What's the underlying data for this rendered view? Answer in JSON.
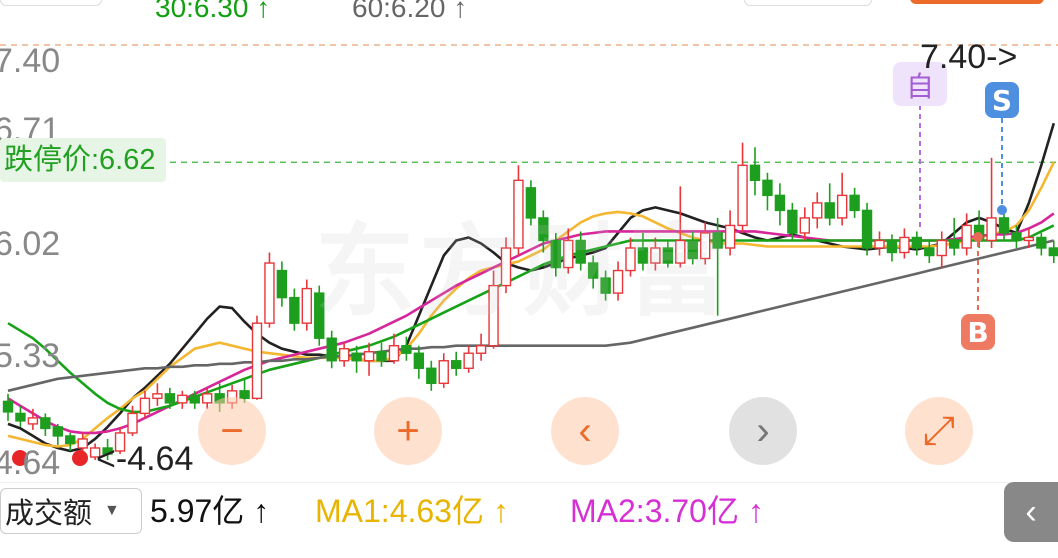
{
  "top_bar": {
    "ma30": "30:6.30",
    "ma60": "60:6.20",
    "up_arrow": "↑"
  },
  "price_axis": [
    "7.40",
    "6.71",
    "6.02",
    "5.33",
    "4.64"
  ],
  "limit_down_label": "跌停价:6.62",
  "high_marker": "7.40->",
  "low_marker": "<-4.64",
  "badges": {
    "self": "自",
    "sell": "S",
    "buy": "B"
  },
  "nav_buttons": {
    "zoom_out": "−",
    "zoom_in": "+",
    "prev": "‹",
    "next": "›",
    "expand": "⤢"
  },
  "volume_bar": {
    "selector": "成交额",
    "value": "5.97亿 ↑",
    "ma1": "MA1:4.63亿 ↑",
    "ma2": "MA2:3.70亿 ↑",
    "collapse": "‹"
  },
  "watermark": "东方财富",
  "colors": {
    "up": "#e8363a",
    "down": "#1e9e1e",
    "ma5": "#222222",
    "ma10": "#f5b731",
    "ma20": "#d6269a",
    "ma30": "#17a317",
    "ma60": "#666666",
    "accent": "#ec6a2a",
    "ma1_text": "#e8b400",
    "ma2_text": "#d62fd6"
  },
  "chart_data": {
    "type": "candlestick",
    "y_axis_ticks": [
      7.4,
      6.71,
      6.02,
      5.33,
      4.64
    ],
    "ylim": [
      4.4,
      7.55
    ],
    "reference_lines": {
      "high": 7.4,
      "limit_down": 6.62
    },
    "candles": [
      {
        "o": 5.03,
        "c": 4.96,
        "h": 5.08,
        "l": 4.9
      },
      {
        "o": 4.95,
        "c": 4.9,
        "h": 5.0,
        "l": 4.86
      },
      {
        "o": 4.88,
        "c": 4.92,
        "h": 4.98,
        "l": 4.84
      },
      {
        "o": 4.92,
        "c": 4.85,
        "h": 4.95,
        "l": 4.8
      },
      {
        "o": 4.86,
        "c": 4.8,
        "h": 4.88,
        "l": 4.74
      },
      {
        "o": 4.8,
        "c": 4.75,
        "h": 4.82,
        "l": 4.7
      },
      {
        "o": 4.72,
        "c": 4.78,
        "h": 4.82,
        "l": 4.66
      },
      {
        "o": 4.66,
        "c": 4.72,
        "h": 4.75,
        "l": 4.64
      },
      {
        "o": 4.72,
        "c": 4.68,
        "h": 4.78,
        "l": 4.64
      },
      {
        "o": 4.7,
        "c": 4.82,
        "h": 4.86,
        "l": 4.68
      },
      {
        "o": 4.82,
        "c": 4.95,
        "h": 5.0,
        "l": 4.8
      },
      {
        "o": 4.95,
        "c": 5.05,
        "h": 5.1,
        "l": 4.92
      },
      {
        "o": 5.05,
        "c": 5.08,
        "h": 5.15,
        "l": 5.0
      },
      {
        "o": 5.08,
        "c": 5.02,
        "h": 5.12,
        "l": 4.98
      },
      {
        "o": 5.02,
        "c": 5.07,
        "h": 5.1,
        "l": 4.98
      },
      {
        "o": 5.07,
        "c": 5.02,
        "h": 5.1,
        "l": 4.98
      },
      {
        "o": 5.02,
        "c": 5.08,
        "h": 5.12,
        "l": 4.98
      },
      {
        "o": 5.08,
        "c": 5.02,
        "h": 5.15,
        "l": 4.96
      },
      {
        "o": 5.02,
        "c": 5.1,
        "h": 5.14,
        "l": 4.98
      },
      {
        "o": 5.1,
        "c": 5.05,
        "h": 5.18,
        "l": 5.02
      },
      {
        "o": 5.05,
        "c": 5.55,
        "h": 5.6,
        "l": 5.04
      },
      {
        "o": 5.55,
        "c": 5.95,
        "h": 6.02,
        "l": 5.52
      },
      {
        "o": 5.9,
        "c": 5.72,
        "h": 5.96,
        "l": 5.66
      },
      {
        "o": 5.72,
        "c": 5.55,
        "h": 5.78,
        "l": 5.5
      },
      {
        "o": 5.55,
        "c": 5.78,
        "h": 5.84,
        "l": 5.5
      },
      {
        "o": 5.75,
        "c": 5.45,
        "h": 5.8,
        "l": 5.4
      },
      {
        "o": 5.45,
        "c": 5.3,
        "h": 5.5,
        "l": 5.25
      },
      {
        "o": 5.3,
        "c": 5.38,
        "h": 5.42,
        "l": 5.26
      },
      {
        "o": 5.35,
        "c": 5.3,
        "h": 5.4,
        "l": 5.22
      },
      {
        "o": 5.3,
        "c": 5.36,
        "h": 5.42,
        "l": 5.2
      },
      {
        "o": 5.36,
        "c": 5.3,
        "h": 5.42,
        "l": 5.26
      },
      {
        "o": 5.3,
        "c": 5.4,
        "h": 5.48,
        "l": 5.28
      },
      {
        "o": 5.4,
        "c": 5.35,
        "h": 5.46,
        "l": 5.3
      },
      {
        "o": 5.35,
        "c": 5.25,
        "h": 5.4,
        "l": 5.18
      },
      {
        "o": 5.25,
        "c": 5.15,
        "h": 5.3,
        "l": 5.1
      },
      {
        "o": 5.15,
        "c": 5.3,
        "h": 5.35,
        "l": 5.12
      },
      {
        "o": 5.3,
        "c": 5.25,
        "h": 5.36,
        "l": 5.2
      },
      {
        "o": 5.25,
        "c": 5.35,
        "h": 5.4,
        "l": 5.22
      },
      {
        "o": 5.35,
        "c": 5.4,
        "h": 5.48,
        "l": 5.3
      },
      {
        "o": 5.4,
        "c": 5.8,
        "h": 5.9,
        "l": 5.38
      },
      {
        "o": 5.8,
        "c": 6.05,
        "h": 6.12,
        "l": 5.75
      },
      {
        "o": 6.05,
        "c": 6.5,
        "h": 6.6,
        "l": 6.0
      },
      {
        "o": 6.45,
        "c": 6.25,
        "h": 6.5,
        "l": 6.2
      },
      {
        "o": 6.25,
        "c": 6.1,
        "h": 6.3,
        "l": 6.02
      },
      {
        "o": 6.1,
        "c": 5.92,
        "h": 6.15,
        "l": 5.86
      },
      {
        "o": 5.92,
        "c": 6.1,
        "h": 6.18,
        "l": 5.88
      },
      {
        "o": 6.1,
        "c": 5.95,
        "h": 6.16,
        "l": 5.9
      },
      {
        "o": 5.95,
        "c": 5.85,
        "h": 6.0,
        "l": 5.78
      },
      {
        "o": 5.85,
        "c": 5.75,
        "h": 5.9,
        "l": 5.7
      },
      {
        "o": 5.75,
        "c": 5.9,
        "h": 5.96,
        "l": 5.7
      },
      {
        "o": 5.9,
        "c": 6.05,
        "h": 6.12,
        "l": 5.86
      },
      {
        "o": 6.05,
        "c": 5.95,
        "h": 6.15,
        "l": 5.9
      },
      {
        "o": 5.95,
        "c": 6.05,
        "h": 6.12,
        "l": 5.9
      },
      {
        "o": 6.05,
        "c": 5.95,
        "h": 6.1,
        "l": 5.92
      },
      {
        "o": 5.95,
        "c": 6.1,
        "h": 6.46,
        "l": 5.92
      },
      {
        "o": 6.1,
        "c": 5.98,
        "h": 6.16,
        "l": 5.94
      },
      {
        "o": 5.98,
        "c": 6.15,
        "h": 6.22,
        "l": 5.94
      },
      {
        "o": 6.15,
        "c": 6.05,
        "h": 6.25,
        "l": 5.6
      },
      {
        "o": 6.05,
        "c": 6.2,
        "h": 6.3,
        "l": 6.0
      },
      {
        "o": 6.2,
        "c": 6.6,
        "h": 6.75,
        "l": 6.15
      },
      {
        "o": 6.6,
        "c": 6.5,
        "h": 6.72,
        "l": 6.4
      },
      {
        "o": 6.5,
        "c": 6.4,
        "h": 6.55,
        "l": 6.3
      },
      {
        "o": 6.4,
        "c": 6.3,
        "h": 6.48,
        "l": 6.2
      },
      {
        "o": 6.3,
        "c": 6.15,
        "h": 6.35,
        "l": 6.1
      },
      {
        "o": 6.15,
        "c": 6.25,
        "h": 6.32,
        "l": 6.1
      },
      {
        "o": 6.25,
        "c": 6.35,
        "h": 6.42,
        "l": 6.18
      },
      {
        "o": 6.35,
        "c": 6.25,
        "h": 6.48,
        "l": 6.2
      },
      {
        "o": 6.25,
        "c": 6.4,
        "h": 6.55,
        "l": 6.2
      },
      {
        "o": 6.4,
        "c": 6.3,
        "h": 6.45,
        "l": 6.25
      },
      {
        "o": 6.3,
        "c": 6.05,
        "h": 6.35,
        "l": 6.0
      },
      {
        "o": 6.05,
        "c": 6.1,
        "h": 6.16,
        "l": 6.0
      },
      {
        "o": 6.1,
        "c": 6.02,
        "h": 6.14,
        "l": 5.96
      },
      {
        "o": 6.02,
        "c": 6.12,
        "h": 6.18,
        "l": 5.98
      },
      {
        "o": 6.12,
        "c": 6.05,
        "h": 6.16,
        "l": 6.0
      },
      {
        "o": 6.05,
        "c": 6.0,
        "h": 6.1,
        "l": 5.95
      },
      {
        "o": 6.0,
        "c": 6.1,
        "h": 6.16,
        "l": 5.92
      },
      {
        "o": 6.1,
        "c": 6.05,
        "h": 6.25,
        "l": 6.0
      },
      {
        "o": 6.05,
        "c": 6.2,
        "h": 6.28,
        "l": 6.0
      },
      {
        "o": 6.2,
        "c": 6.1,
        "h": 6.3,
        "l": 6.05
      },
      {
        "o": 6.1,
        "c": 6.25,
        "h": 6.65,
        "l": 6.05
      },
      {
        "o": 6.25,
        "c": 6.15,
        "h": 6.3,
        "l": 6.1
      },
      {
        "o": 6.15,
        "c": 6.1,
        "h": 6.2,
        "l": 6.05
      },
      {
        "o": 6.1,
        "c": 6.12,
        "h": 6.18,
        "l": 6.05
      },
      {
        "o": 6.12,
        "c": 6.05,
        "h": 6.15,
        "l": 6.0
      },
      {
        "o": 6.05,
        "c": 6.0,
        "h": 6.1,
        "l": 5.95
      },
      {
        "o": 6.0,
        "c": 6.05,
        "h": 6.12,
        "l": 5.98
      },
      {
        "o": 6.05,
        "c": 6.02,
        "h": 6.1,
        "l": 5.98
      },
      {
        "o": 6.02,
        "c": 6.06,
        "h": 6.12,
        "l": 5.98
      },
      {
        "o": 6.06,
        "c": 6.02,
        "h": 6.14,
        "l": 5.98
      },
      {
        "o": 6.02,
        "c": 6.08,
        "h": 6.14,
        "l": 6.0
      },
      {
        "o": 6.08,
        "c": 6.04,
        "h": 6.14,
        "l": 6.0
      },
      {
        "o": 6.04,
        "c": 6.15,
        "h": 6.55,
        "l": 6.02
      },
      {
        "o": 6.15,
        "c": 6.35,
        "h": 6.42,
        "l": 6.1
      },
      {
        "o": 6.35,
        "c": 6.42,
        "h": 6.5,
        "l": 6.3
      },
      {
        "o": 6.42,
        "c": 6.25,
        "h": 6.48,
        "l": 6.2
      },
      {
        "o": 6.25,
        "c": 6.1,
        "h": 6.3,
        "l": 6.05
      },
      {
        "o": 6.1,
        "c": 6.02,
        "h": 6.16,
        "l": 5.98
      },
      {
        "o": 6.02,
        "c": 6.05,
        "h": 6.1,
        "l": 6.0
      },
      {
        "o": 6.05,
        "c": 6.15,
        "h": 6.25,
        "l": 6.02
      },
      {
        "o": 6.15,
        "c": 6.62,
        "h": 6.78,
        "l": 6.12
      },
      {
        "o": 6.62,
        "c": 7.3,
        "h": 7.4,
        "l": 6.6
      },
      {
        "o": 7.3,
        "c": 6.9,
        "h": 7.48,
        "l": 6.85
      }
    ],
    "ma_series": [
      {
        "name": "MA5",
        "color_key": "ma5",
        "values": [
          4.88,
          4.85,
          4.8,
          4.75,
          4.72,
          4.7,
          4.72,
          4.78,
          4.86,
          4.95,
          5.05,
          5.12,
          5.2,
          5.28,
          5.38,
          5.48,
          5.58,
          5.66,
          5.65,
          5.56,
          5.48,
          5.42,
          5.38,
          5.36,
          5.34,
          5.34,
          5.33,
          5.32,
          5.31,
          5.3,
          5.3,
          5.3,
          5.4,
          5.6,
          5.8,
          6.0,
          6.1,
          6.12,
          6.08,
          6.02,
          5.95,
          5.92,
          5.9,
          5.92,
          5.95,
          5.98,
          6.0,
          6.02,
          6.05,
          6.15,
          6.25,
          6.3,
          6.32,
          6.3,
          6.28,
          6.25,
          6.22,
          6.2,
          6.18,
          6.15,
          6.12,
          6.1,
          6.12,
          6.14,
          6.12,
          6.1,
          6.08,
          6.06,
          6.05,
          6.04,
          6.05,
          6.06,
          6.05,
          6.04,
          6.06,
          6.08,
          6.15,
          6.22,
          6.25,
          6.22,
          6.18,
          6.15,
          6.35,
          6.6,
          6.88
        ]
      },
      {
        "name": "MA10",
        "color_key": "ma10",
        "values": [
          4.8,
          4.78,
          4.76,
          4.74,
          4.73,
          4.74,
          4.78,
          4.85,
          4.92,
          4.98,
          5.05,
          5.1,
          5.18,
          5.26,
          5.32,
          5.38,
          5.4,
          5.42,
          5.4,
          5.38,
          5.36,
          5.35,
          5.34,
          5.33,
          5.32,
          5.32,
          5.32,
          5.32,
          5.31,
          5.3,
          5.3,
          5.32,
          5.38,
          5.48,
          5.6,
          5.7,
          5.78,
          5.85,
          5.9,
          5.92,
          5.94,
          5.96,
          6.0,
          6.04,
          6.1,
          6.16,
          6.22,
          6.26,
          6.28,
          6.29,
          6.28,
          6.26,
          6.22,
          6.18,
          6.15,
          6.12,
          6.1,
          6.08,
          6.08,
          6.08,
          6.07,
          6.06,
          6.06,
          6.06,
          6.06,
          6.06,
          6.06,
          6.06,
          6.06,
          6.06,
          6.06,
          6.06,
          6.06,
          6.06,
          6.06,
          6.07,
          6.08,
          6.1,
          6.12,
          6.14,
          6.16,
          6.2,
          6.3,
          6.45,
          6.62
        ]
      },
      {
        "name": "MA20",
        "color_key": "ma20",
        "values": [
          5.05,
          5.0,
          4.95,
          4.9,
          4.86,
          4.83,
          4.82,
          4.82,
          4.83,
          4.85,
          4.88,
          4.92,
          4.96,
          5.0,
          5.04,
          5.08,
          5.12,
          5.16,
          5.2,
          5.24,
          5.27,
          5.3,
          5.32,
          5.34,
          5.36,
          5.38,
          5.4,
          5.42,
          5.45,
          5.48,
          5.52,
          5.56,
          5.6,
          5.65,
          5.7,
          5.75,
          5.8,
          5.84,
          5.88,
          5.92,
          5.96,
          6.0,
          6.04,
          6.08,
          6.1,
          6.12,
          6.14,
          6.15,
          6.16,
          6.16,
          6.16,
          6.16,
          6.16,
          6.16,
          6.16,
          6.16,
          6.16,
          6.16,
          6.16,
          6.16,
          6.16,
          6.15,
          6.14,
          6.13,
          6.12,
          6.11,
          6.1,
          6.1,
          6.1,
          6.1,
          6.1,
          6.1,
          6.1,
          6.1,
          6.1,
          6.1,
          6.11,
          6.12,
          6.13,
          6.14,
          6.14,
          6.15,
          6.18,
          6.22,
          6.28
        ]
      },
      {
        "name": "MA30",
        "color_key": "ma30",
        "values": [
          5.55,
          5.5,
          5.45,
          5.38,
          5.3,
          5.22,
          5.15,
          5.08,
          5.02,
          4.98,
          4.96,
          4.96,
          4.98,
          5.0,
          5.03,
          5.06,
          5.09,
          5.12,
          5.15,
          5.18,
          5.21,
          5.24,
          5.26,
          5.28,
          5.3,
          5.32,
          5.34,
          5.36,
          5.38,
          5.4,
          5.43,
          5.46,
          5.5,
          5.54,
          5.58,
          5.62,
          5.66,
          5.7,
          5.74,
          5.78,
          5.82,
          5.86,
          5.9,
          5.94,
          5.97,
          6.0,
          6.02,
          6.04,
          6.06,
          6.08,
          6.1,
          6.1,
          6.1,
          6.1,
          6.1,
          6.1,
          6.1,
          6.1,
          6.1,
          6.1,
          6.1,
          6.1,
          6.1,
          6.1,
          6.1,
          6.1,
          6.1,
          6.1,
          6.1,
          6.1,
          6.1,
          6.1,
          6.1,
          6.1,
          6.1,
          6.1,
          6.1,
          6.1,
          6.1,
          6.1,
          6.1,
          6.1,
          6.12,
          6.16,
          6.2
        ]
      },
      {
        "name": "MA60",
        "color_key": "ma60",
        "values": [
          5.1,
          5.12,
          5.14,
          5.16,
          5.18,
          5.19,
          5.2,
          5.21,
          5.22,
          5.23,
          5.24,
          5.25,
          5.25,
          5.26,
          5.26,
          5.27,
          5.27,
          5.28,
          5.28,
          5.29,
          5.29,
          5.3,
          5.3,
          5.31,
          5.31,
          5.32,
          5.33,
          5.33,
          5.34,
          5.35,
          5.36,
          5.37,
          5.38,
          5.38,
          5.39,
          5.39,
          5.4,
          5.4,
          5.4,
          5.4,
          5.4,
          5.4,
          5.4,
          5.4,
          5.4,
          5.4,
          5.4,
          5.4,
          5.4,
          5.41,
          5.42,
          5.44,
          5.46,
          5.48,
          5.5,
          5.52,
          5.54,
          5.56,
          5.58,
          5.6,
          5.62,
          5.64,
          5.66,
          5.68,
          5.7,
          5.72,
          5.74,
          5.76,
          5.78,
          5.8,
          5.82,
          5.84,
          5.86,
          5.88,
          5.9,
          5.92,
          5.94,
          5.96,
          5.98,
          6.0,
          6.02,
          6.04,
          6.06,
          6.08,
          6.1
        ]
      }
    ]
  }
}
